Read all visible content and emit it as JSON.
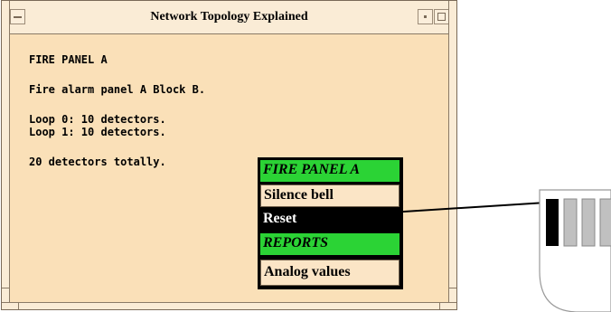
{
  "window": {
    "title": "Network Topology Explained"
  },
  "content": {
    "heading": "FIRE PANEL A",
    "description": "Fire alarm panel A Block B.",
    "loops": [
      "Loop 0: 10 detectors.",
      "Loop 1: 10 detectors."
    ],
    "total": "20 detectors totally."
  },
  "popup_menu": {
    "header_1": "FIRE PANEL A",
    "item_silence": "Silence bell",
    "item_reset": "Reset",
    "header_2": "REPORTS",
    "item_analog": "Analog values",
    "selected_item": "Reset"
  },
  "colors": {
    "window_background": "#fae0b8",
    "menu_header": "#2bd335",
    "menu_item": "#fbe5c6",
    "menu_selected": "#000000",
    "device_bar_dark": "#000000",
    "device_bar_light": "#c0c0c0"
  }
}
